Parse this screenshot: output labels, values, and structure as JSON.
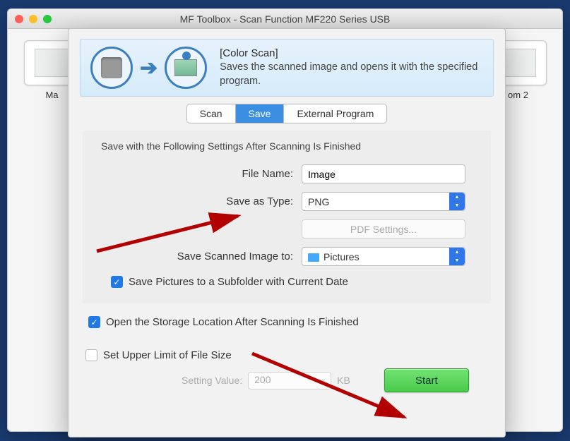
{
  "window": {
    "title": "MF Toolbox - Scan Function MF220 Series USB"
  },
  "parent_tiles": {
    "left_label": "Ma",
    "right_label": "om 2"
  },
  "header": {
    "title": "[Color Scan]",
    "desc": "Saves the scanned image and opens it with the specified program."
  },
  "tabs": {
    "scan": "Scan",
    "save": "Save",
    "external": "External Program"
  },
  "panel": {
    "title": "Save with the Following Settings After Scanning Is Finished",
    "filename_label": "File Name:",
    "filename_value": "Image",
    "savetype_label": "Save as Type:",
    "savetype_value": "PNG",
    "pdf_btn": "PDF Settings...",
    "saveto_label": "Save Scanned Image to:",
    "saveto_value": "Pictures",
    "subfolder_label": "Save Pictures to a Subfolder with Current Date"
  },
  "open_location_label": "Open the Storage Location After Scanning Is Finished",
  "bottom": {
    "upper_limit_label": "Set Upper Limit of File Size",
    "setting_value_label": "Setting Value:",
    "setting_value": "200",
    "kb": "KB",
    "start": "Start"
  }
}
